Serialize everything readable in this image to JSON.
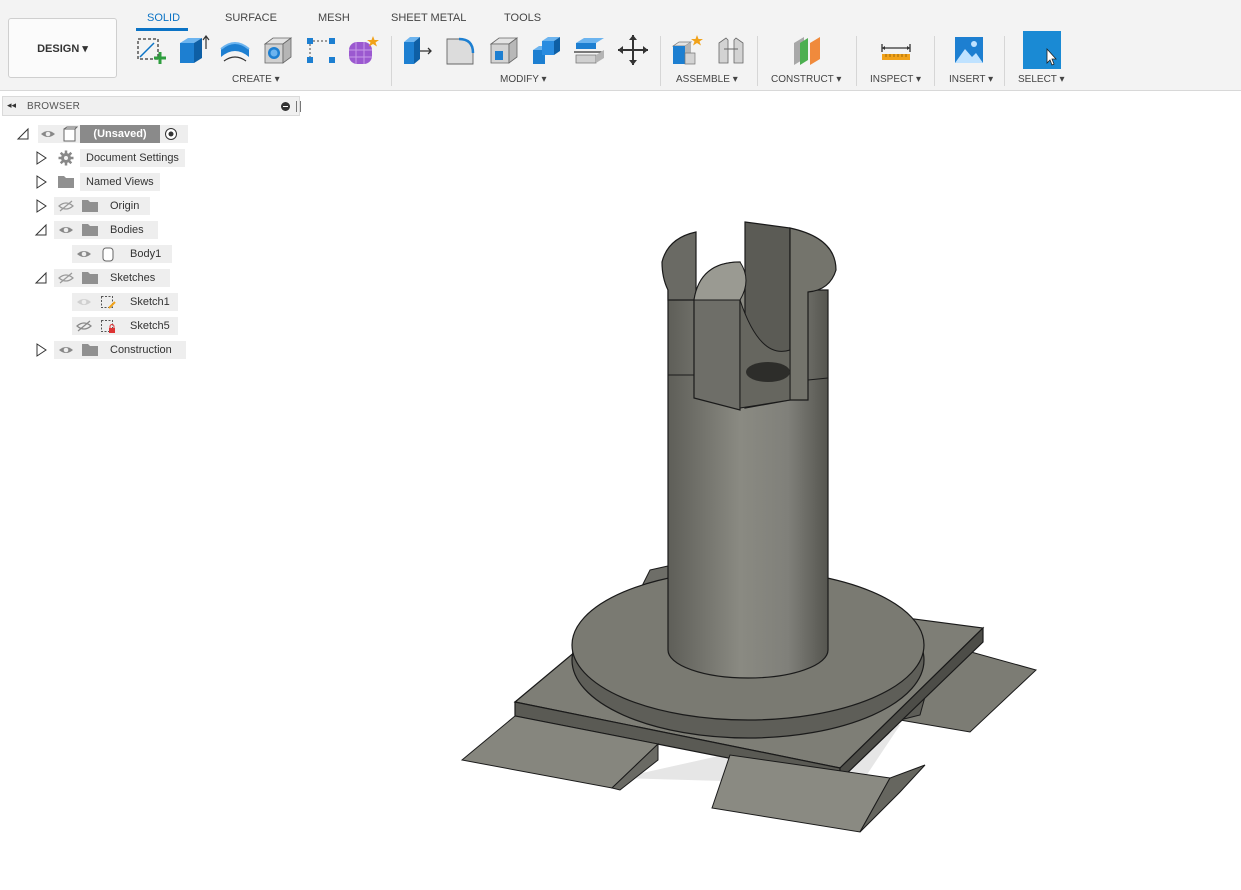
{
  "workspace": {
    "label": "DESIGN ▾"
  },
  "tabs": [
    {
      "label": "SOLID",
      "active": true
    },
    {
      "label": "SURFACE"
    },
    {
      "label": "MESH"
    },
    {
      "label": "SHEET METAL"
    },
    {
      "label": "TOOLS"
    }
  ],
  "groups": {
    "create": "CREATE ▾",
    "modify": "MODIFY ▾",
    "assemble": "ASSEMBLE ▾",
    "construct": "CONSTRUCT ▾",
    "inspect": "INSPECT ▾",
    "insert": "INSERT ▾",
    "select": "SELECT ▾"
  },
  "browser": {
    "title": "BROWSER",
    "root": "(Unsaved)",
    "items": {
      "document_settings": "Document Settings",
      "named_views": "Named Views",
      "origin": "Origin",
      "bodies": "Bodies",
      "body1": "Body1",
      "sketches": "Sketches",
      "sketch1": "Sketch1",
      "sketch5": "Sketch5",
      "construction": "Construction"
    }
  },
  "colors": {
    "accent": "#0b73c5",
    "model_fill": "#7a7a72",
    "model_edge": "#1a1a1a"
  }
}
